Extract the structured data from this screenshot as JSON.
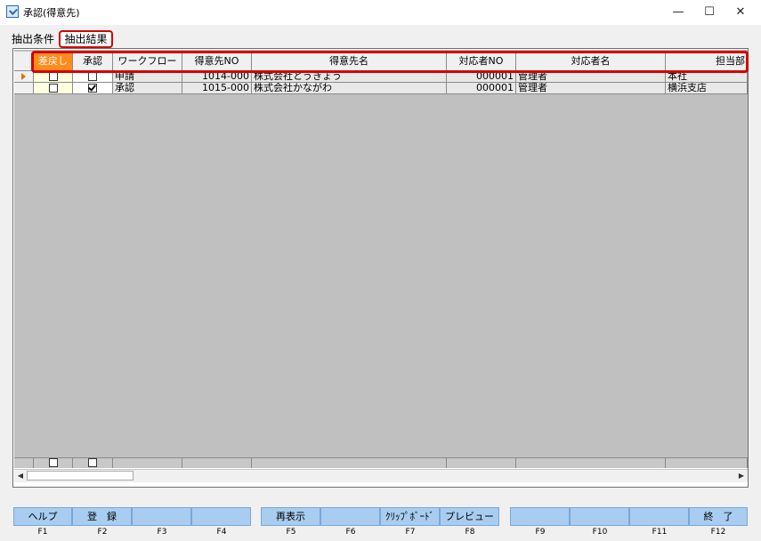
{
  "window": {
    "title": "承認(得意先)",
    "minimize": "—",
    "maximize": "☐",
    "close": "✕"
  },
  "tabs": [
    "抽出条件",
    "抽出結果"
  ],
  "columns": [
    "差戻し",
    "承認",
    "ワークフロー",
    "得意先NO",
    "得意先名",
    "対応者NO",
    "対応者名",
    "担当部"
  ],
  "rows": [
    {
      "sendback": false,
      "approve": false,
      "workflow": "申請",
      "customer_no": "1014-000",
      "customer_name": "株式会社とうきょう",
      "handler_no": "000001",
      "handler_name": "管理者",
      "dept": "本社"
    },
    {
      "sendback": false,
      "approve": true,
      "workflow": "承認",
      "customer_no": "1015-000",
      "customer_name": "株式会社かながわ",
      "handler_no": "000001",
      "handler_name": "管理者",
      "dept": "横浜支店"
    }
  ],
  "function_keys": [
    {
      "label": "ヘルプ",
      "key": "F1"
    },
    {
      "label": "登　録",
      "key": "F2"
    },
    {
      "label": "",
      "key": "F3"
    },
    {
      "label": "",
      "key": "F4"
    },
    {
      "label": "再表示",
      "key": "F5"
    },
    {
      "label": "",
      "key": "F6"
    },
    {
      "label": "ｸﾘｯﾌﾟﾎﾞｰﾄﾞ",
      "key": "F7"
    },
    {
      "label": "プレビュー",
      "key": "F8"
    },
    {
      "label": "",
      "key": "F9"
    },
    {
      "label": "",
      "key": "F10"
    },
    {
      "label": "",
      "key": "F11"
    },
    {
      "label": "終　了",
      "key": "F12"
    }
  ],
  "colors": {
    "highlight_border": "#d40000",
    "selected_header": "#ff8c1a",
    "function_key_bg": "#a8cdf0"
  }
}
